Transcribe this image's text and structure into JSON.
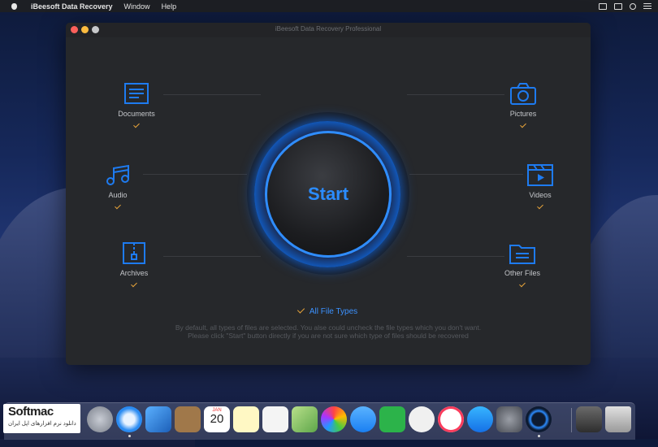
{
  "menubar": {
    "app_name": "iBeesoft Data Recovery",
    "items": [
      "Window",
      "Help"
    ]
  },
  "window": {
    "title": "iBeesoft Data Recovery Professional"
  },
  "categories": {
    "documents": "Documents",
    "audio": "Audio",
    "archives": "Archives",
    "pictures": "Pictures",
    "videos": "Videos",
    "other": "Other Files"
  },
  "start_label": "Start",
  "all_file_types": "All File Types",
  "hint_line1": "By default, all types of files are selected. You alse could uncheck the file types which you don't want.",
  "hint_line2": "Please click \"Start\" button directly if you are not sure which type of files should be recovered",
  "watermark": {
    "brand": "Softmac",
    "subtitle": "دانلود نرم افزارهای اپل ایران"
  },
  "calendar": {
    "month": "JAN",
    "day": "20"
  },
  "colors": {
    "accent": "#1e7bf0",
    "check": "#e8a43a",
    "window_bg": "#26282b"
  }
}
